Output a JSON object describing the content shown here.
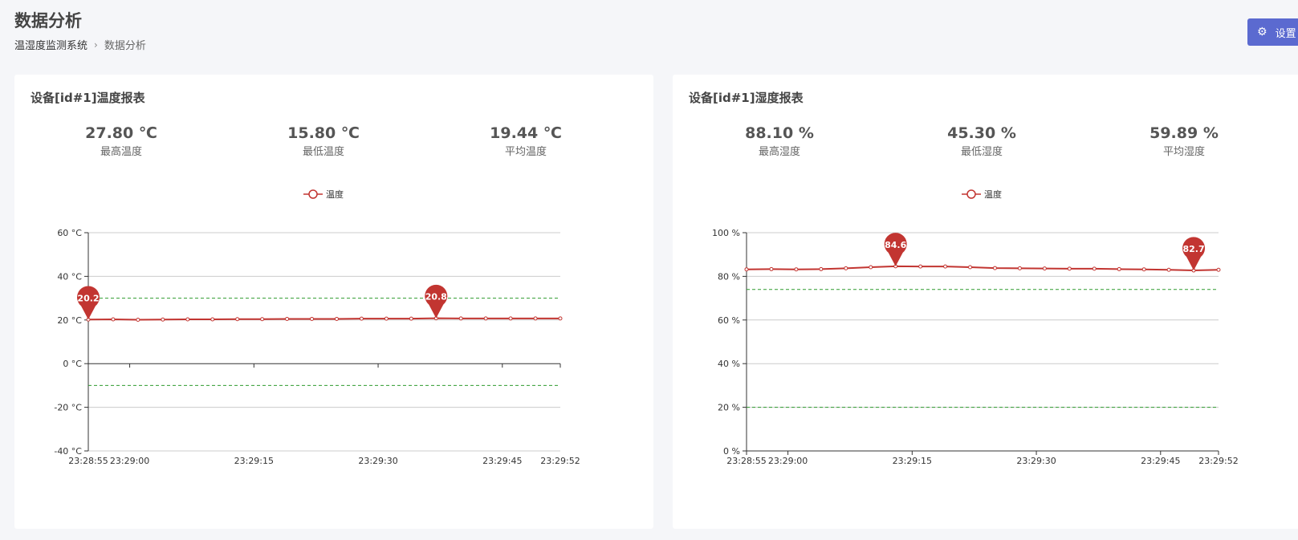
{
  "header": {
    "title": "数据分析",
    "breadcrumb": [
      "温湿度监测系统",
      "数据分析"
    ],
    "settings_label": "设置"
  },
  "colors": {
    "accent": "#5b6ad0",
    "series": "#c23531",
    "markline": "#2e9b2e"
  },
  "cards": [
    {
      "title": "设备[id#1]温度报表",
      "stats": [
        {
          "value": "27.80 ℃",
          "label": "最高温度"
        },
        {
          "value": "15.80 ℃",
          "label": "最低温度"
        },
        {
          "value": "19.44 ℃",
          "label": "平均温度"
        }
      ]
    },
    {
      "title": "设备[id#1]湿度报表",
      "stats": [
        {
          "value": "88.10 %",
          "label": "最高湿度"
        },
        {
          "value": "45.30 %",
          "label": "最低湿度"
        },
        {
          "value": "59.89 %",
          "label": "平均湿度"
        }
      ]
    }
  ],
  "chart_data": [
    {
      "type": "line",
      "legend": "温度",
      "ylim": [
        -40,
        60
      ],
      "yticks": [
        60,
        40,
        20,
        0,
        -20,
        -40
      ],
      "yunit": " °C",
      "x_tick_labels": [
        "23:28:55",
        "23:29:00",
        "23:29:15",
        "23:29:30",
        "23:29:45",
        "23:29:52"
      ],
      "x": [
        "23:28:55",
        "23:28:58",
        "23:29:01",
        "23:29:04",
        "23:29:07",
        "23:29:10",
        "23:29:13",
        "23:29:16",
        "23:29:19",
        "23:29:22",
        "23:29:25",
        "23:29:28",
        "23:29:31",
        "23:29:34",
        "23:29:37",
        "23:29:40",
        "23:29:43",
        "23:29:46",
        "23:29:49",
        "23:29:52"
      ],
      "series": [
        {
          "name": "温度",
          "values": [
            20.2,
            20.3,
            20.1,
            20.2,
            20.3,
            20.3,
            20.4,
            20.4,
            20.5,
            20.5,
            20.5,
            20.6,
            20.6,
            20.6,
            20.8,
            20.7,
            20.7,
            20.7,
            20.7,
            20.7
          ]
        }
      ],
      "markpoints": [
        {
          "label": "20.2",
          "index": 0,
          "value": 20.2
        },
        {
          "label": "20.8",
          "index": 14,
          "value": 20.8
        }
      ],
      "marklines": [
        30,
        -10
      ]
    },
    {
      "type": "line",
      "legend": "温度",
      "ylim": [
        0,
        100
      ],
      "yticks": [
        100,
        80,
        60,
        40,
        20,
        0
      ],
      "yunit": " %",
      "x_tick_labels": [
        "23:28:55",
        "23:29:00",
        "23:29:15",
        "23:29:30",
        "23:29:45",
        "23:29:52"
      ],
      "x": [
        "23:28:55",
        "23:28:58",
        "23:29:01",
        "23:29:04",
        "23:29:07",
        "23:29:10",
        "23:29:13",
        "23:29:16",
        "23:29:19",
        "23:29:22",
        "23:29:25",
        "23:29:28",
        "23:29:31",
        "23:29:34",
        "23:29:37",
        "23:29:40",
        "23:29:43",
        "23:29:46",
        "23:29:49",
        "23:29:52"
      ],
      "series": [
        {
          "name": "温度",
          "values": [
            83.2,
            83.3,
            83.2,
            83.3,
            83.7,
            84.2,
            84.6,
            84.5,
            84.5,
            84.2,
            83.8,
            83.7,
            83.6,
            83.5,
            83.5,
            83.3,
            83.2,
            83.0,
            82.7,
            83.0
          ]
        }
      ],
      "markpoints": [
        {
          "label": "84.6",
          "index": 6,
          "value": 84.6
        },
        {
          "label": "82.7",
          "index": 18,
          "value": 82.7
        }
      ],
      "marklines": [
        74,
        20
      ]
    }
  ]
}
